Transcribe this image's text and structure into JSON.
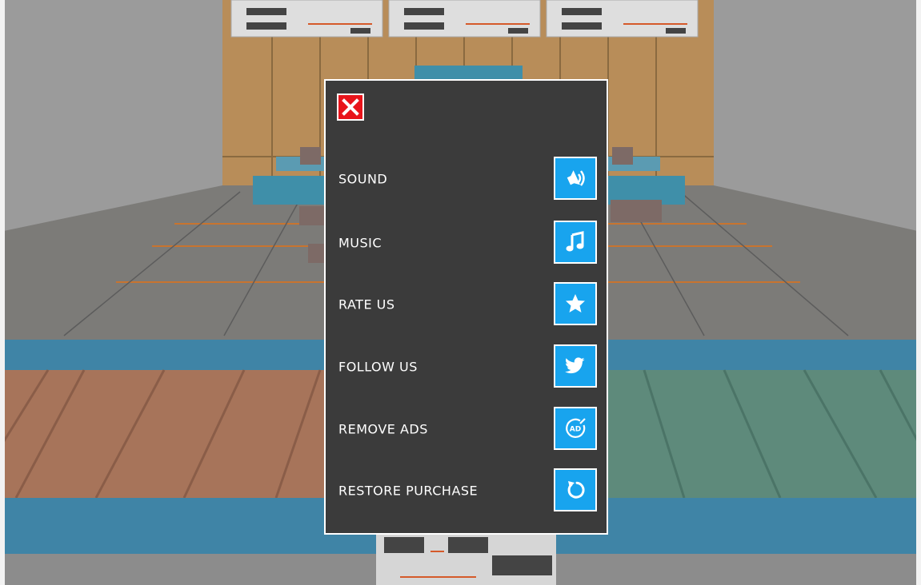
{
  "colors": {
    "panel_bg": "#3b3b3b",
    "panel_border": "#ffffff",
    "button_bg": "#18a4ee",
    "close_bg": "#e8141b",
    "label_text": "#ffffff"
  },
  "settings_panel": {
    "close_icon": "close-x-icon",
    "rows": [
      {
        "label": "SOUND",
        "icon": "sound-icon"
      },
      {
        "label": "MUSIC",
        "icon": "music-note-icon"
      },
      {
        "label": "RATE US",
        "icon": "star-icon"
      },
      {
        "label": "FOLLOW US",
        "icon": "twitter-bird-icon"
      },
      {
        "label": "REMOVE ADS",
        "icon": "remove-ads-icon"
      },
      {
        "label": "RESTORE PURCHASE",
        "icon": "restore-icon"
      }
    ]
  }
}
